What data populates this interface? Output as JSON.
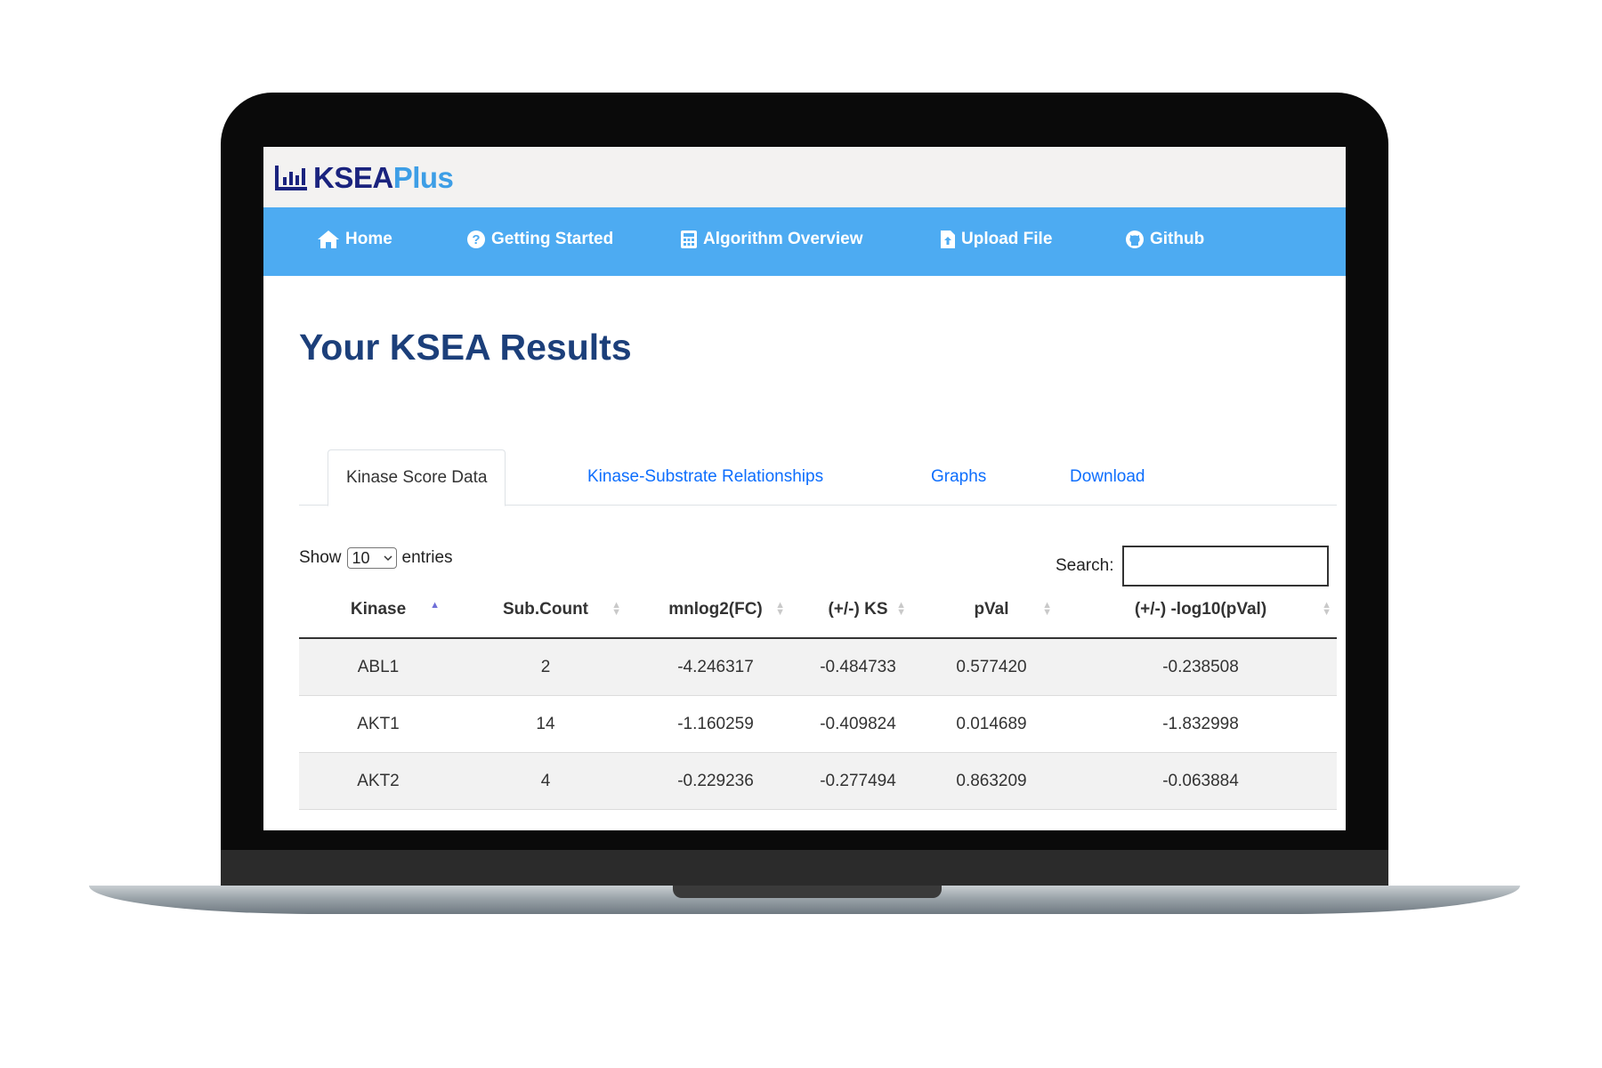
{
  "brand": {
    "name_main": "KSEA",
    "name_accent": "Plus"
  },
  "nav": [
    {
      "label": "Home",
      "icon": "home-icon"
    },
    {
      "label": "Getting Started",
      "icon": "question-circle-icon"
    },
    {
      "label": "Algorithm Overview",
      "icon": "calculator-icon"
    },
    {
      "label": "Upload File",
      "icon": "file-upload-icon"
    },
    {
      "label": "Github",
      "icon": "github-icon"
    }
  ],
  "page_title": "Your KSEA Results",
  "tabs": [
    {
      "label": "Kinase Score Data",
      "active": true
    },
    {
      "label": "Kinase-Substrate Relationships",
      "active": false
    },
    {
      "label": "Graphs",
      "active": false
    },
    {
      "label": "Download",
      "active": false
    }
  ],
  "length_control": {
    "prefix": "Show",
    "selected": "10",
    "suffix": "entries"
  },
  "search": {
    "label": "Search:",
    "value": ""
  },
  "table": {
    "columns": [
      "Kinase",
      "Sub.Count",
      "mnlog2(FC)",
      "(+/-) KS",
      "pVal",
      "(+/-) -log10(pVal)"
    ],
    "sorted_column": "Kinase",
    "sort_direction": "ascending",
    "rows": [
      [
        "ABL1",
        "2",
        "-4.246317",
        "-0.484733",
        "0.577420",
        "-0.238508"
      ],
      [
        "AKT1",
        "14",
        "-1.160259",
        "-0.409824",
        "0.014689",
        "-1.832998"
      ],
      [
        "AKT2",
        "4",
        "-0.229236",
        "-0.277494",
        "0.863209",
        "-0.063884"
      ]
    ]
  },
  "colors": {
    "navbar": "#4dabf2",
    "brand_dark": "#1a237e",
    "brand_accent": "#3d9ee6",
    "title": "#1c3f7a",
    "tab_link": "#0d6efd"
  }
}
